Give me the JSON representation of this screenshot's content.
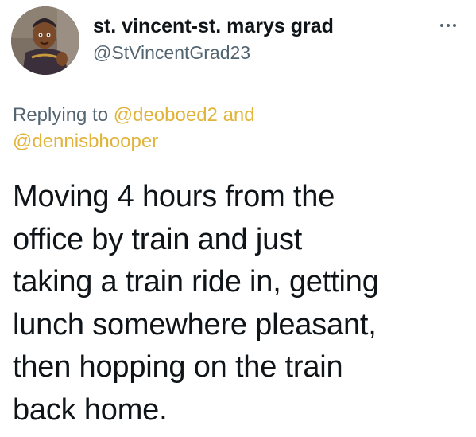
{
  "tweet": {
    "author": {
      "display_name": "st. vincent-st. marys grad",
      "handle": "@StVincentGrad23"
    },
    "more_icon": "more-horizontal-icon",
    "reply_context": {
      "prefix": "Replying to",
      "mention_1": "@deoboed2",
      "joiner": "and",
      "mention_2": "@dennisbhooper"
    },
    "body_lines": [
      "Moving 4 hours from the",
      "office by train and just",
      "taking a train ride in, getting",
      "lunch somewhere pleasant,",
      "then hopping on the train",
      "back home."
    ],
    "colors": {
      "mention": "#e1b33a",
      "secondary_text": "#536471",
      "primary_text": "#0f1419"
    }
  }
}
